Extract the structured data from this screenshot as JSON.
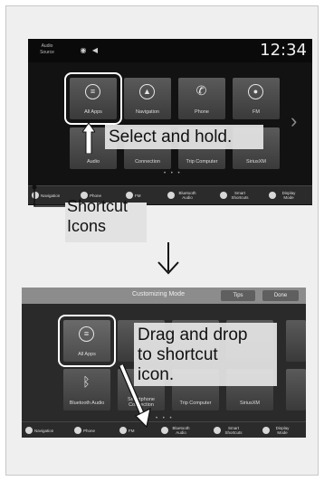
{
  "screen1": {
    "status": {
      "source_label": "Audio Source",
      "clock": "12:34"
    },
    "tiles": [
      {
        "label": "All Apps",
        "icon": "apps-icon"
      },
      {
        "label": "Navigation",
        "icon": "compass-icon"
      },
      {
        "label": "Phone",
        "icon": "phone-icon"
      },
      {
        "label": "FM",
        "icon": "radio-icon"
      },
      {
        "label": "Audio",
        "icon": "audio-icon"
      },
      {
        "label": "Connection",
        "icon": "connection-icon"
      },
      {
        "label": "Trip Computer",
        "icon": "trip-icon"
      },
      {
        "label": "SiriusXM",
        "icon": "satellite-icon"
      }
    ],
    "shortcuts": [
      {
        "label": "Navigation",
        "icon": "navigation-icon"
      },
      {
        "label": "Phone",
        "icon": "phone-icon"
      },
      {
        "label": "FM",
        "icon": "radio-icon"
      },
      {
        "label": "Bluetooth Audio",
        "icon": "bluetooth-icon"
      },
      {
        "label": "Smart Shortcuts",
        "icon": "shortcut-icon"
      },
      {
        "label": "Display Mode",
        "icon": "display-icon"
      }
    ]
  },
  "screen2": {
    "title": "Customizing Mode",
    "tips_label": "Tips",
    "done_label": "Done",
    "tiles": [
      {
        "label": "All Apps"
      },
      {
        "label": "Bluetooth Audio"
      },
      {
        "label": "Smartphone Connection"
      },
      {
        "label": "Trip Computer"
      },
      {
        "label": "SiriusXM"
      }
    ],
    "shortcuts": [
      {
        "label": "Navigation"
      },
      {
        "label": "Phone"
      },
      {
        "label": "FM"
      },
      {
        "label": "Bluetooth Audio"
      },
      {
        "label": "Smart Shortcuts"
      },
      {
        "label": "Display Mode"
      }
    ]
  },
  "callouts": {
    "select_hold": "Select and hold.",
    "shortcut_icons_line1": "Shortcut",
    "shortcut_icons_line2": "Icons",
    "drag_drop_line1": "Drag and drop",
    "drag_drop_line2": "to shortcut",
    "drag_drop_line3": "icon."
  },
  "colors": {
    "highlight": "#ffffff",
    "tile": "#4a4a4a",
    "bar": "#2b2b2b"
  }
}
